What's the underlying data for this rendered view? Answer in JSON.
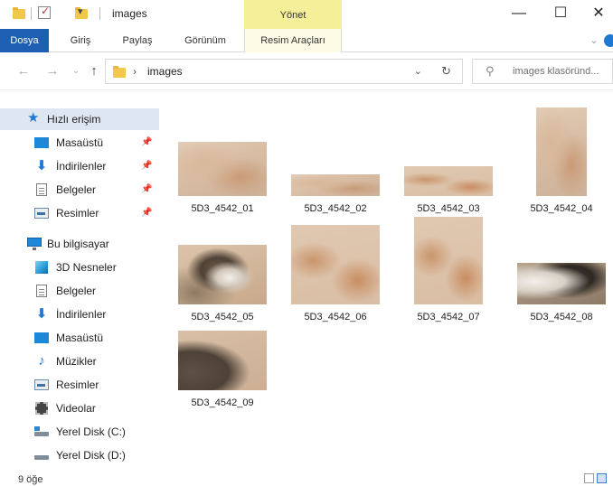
{
  "window": {
    "title": "images",
    "context_tab_group": "Yönet",
    "controls": {
      "minimize": "—",
      "maximize": "☐",
      "close": "✕"
    }
  },
  "ribbon": {
    "tabs": [
      {
        "label": "Dosya",
        "active": true
      },
      {
        "label": "Giriş"
      },
      {
        "label": "Paylaş"
      },
      {
        "label": "Görünüm"
      },
      {
        "label": "Resim Araçları"
      }
    ]
  },
  "address": {
    "path_separator": "›",
    "current": "images",
    "search_placeholder": "images klasöründ..."
  },
  "sidebar": {
    "quick_access": {
      "label": "Hızlı erişim"
    },
    "pinned": [
      {
        "label": "Masaüstü",
        "icon": "desktop-icon"
      },
      {
        "label": "İndirilenler",
        "icon": "download-arrow-icon"
      },
      {
        "label": "Belgeler",
        "icon": "document-icon"
      },
      {
        "label": "Resimler",
        "icon": "pictures-icon"
      }
    ],
    "this_pc": {
      "label": "Bu bilgisayar"
    },
    "pc_items": [
      {
        "label": "3D Nesneler",
        "icon": "cube-icon"
      },
      {
        "label": "Belgeler",
        "icon": "document-icon"
      },
      {
        "label": "İndirilenler",
        "icon": "download-arrow-icon"
      },
      {
        "label": "Masaüstü",
        "icon": "desktop-icon"
      },
      {
        "label": "Müzikler",
        "icon": "music-note-icon"
      },
      {
        "label": "Resimler",
        "icon": "pictures-icon"
      },
      {
        "label": "Videolar",
        "icon": "film-icon"
      },
      {
        "label": "Yerel Disk (C:)",
        "icon": "windows-drive-icon"
      },
      {
        "label": "Yerel Disk (D:)",
        "icon": "drive-icon"
      }
    ]
  },
  "files": [
    {
      "name": "5D3_4542_01"
    },
    {
      "name": "5D3_4542_02"
    },
    {
      "name": "5D3_4542_03"
    },
    {
      "name": "5D3_4542_04"
    },
    {
      "name": "5D3_4542_05"
    },
    {
      "name": "5D3_4542_06"
    },
    {
      "name": "5D3_4542_07"
    },
    {
      "name": "5D3_4542_08"
    },
    {
      "name": "5D3_4542_09"
    }
  ],
  "status": {
    "item_count": "9 öğe"
  },
  "colors": {
    "file_tab": "#1e5fb4",
    "context_group": "#f6ef9a",
    "selected_nav": "#dde6f1"
  }
}
